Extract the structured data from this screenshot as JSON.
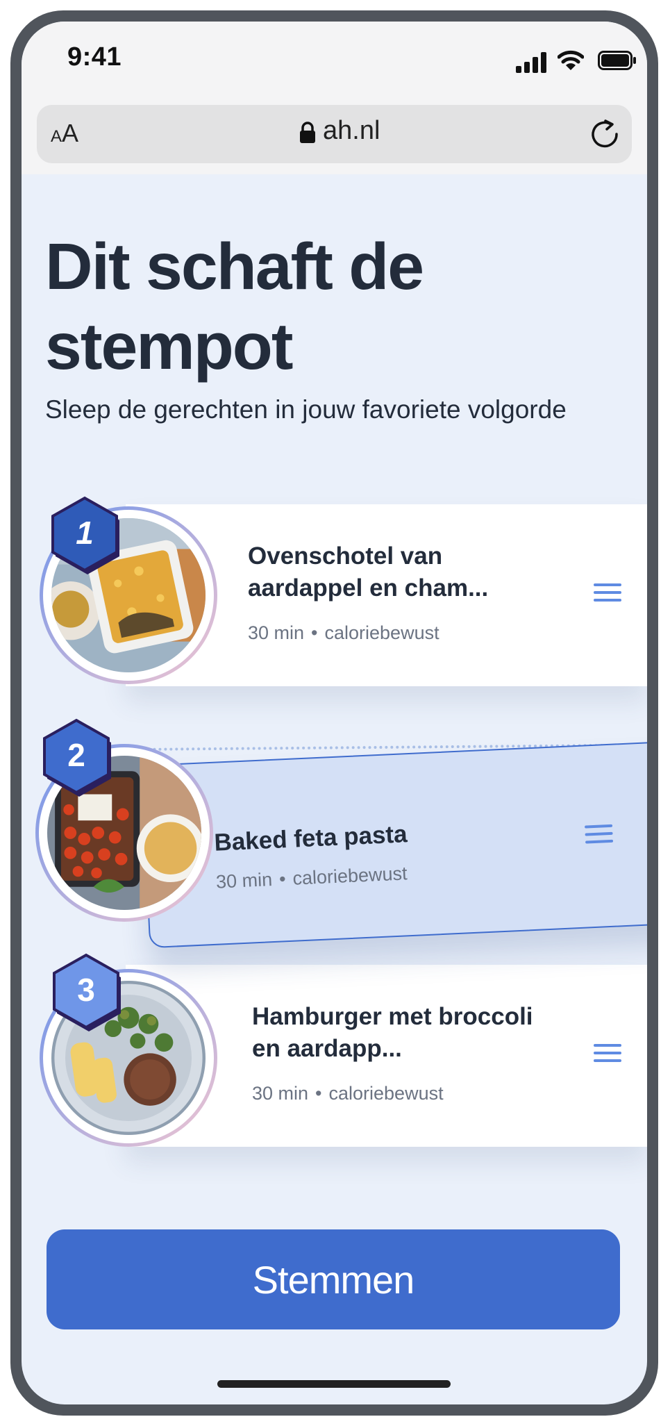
{
  "status": {
    "time": "9:41"
  },
  "browser": {
    "text_size_small": "A",
    "text_size_large": "A",
    "url": "ah.nl"
  },
  "page": {
    "title": "Dit schaft de stempot",
    "subtitle": "Sleep de gerechten in jouw favoriete volgorde"
  },
  "recipes": [
    {
      "rank": "1",
      "title": "Ovenschotel van aardappel en cham...",
      "time": "30 min",
      "tag": "caloriebewust",
      "image": "casserole-photo"
    },
    {
      "rank": "2",
      "title": "Baked feta pasta",
      "time": "30 min",
      "tag": "caloriebewust",
      "image": "feta-pasta-photo"
    },
    {
      "rank": "3",
      "title": "Hamburger met broccoli en aardapp...",
      "time": "30 min",
      "tag": "caloriebewust",
      "image": "hamburger-photo"
    }
  ],
  "action": {
    "vote_label": "Stemmen"
  },
  "colors": {
    "accent": "#3f6ccd",
    "background": "#eaf0fa",
    "text": "#232c3b",
    "badge_1": "#2f5bb8",
    "badge_2": "#3f6ccd",
    "badge_3": "#6f96e8",
    "badge_outline": "#2a1f5e"
  }
}
